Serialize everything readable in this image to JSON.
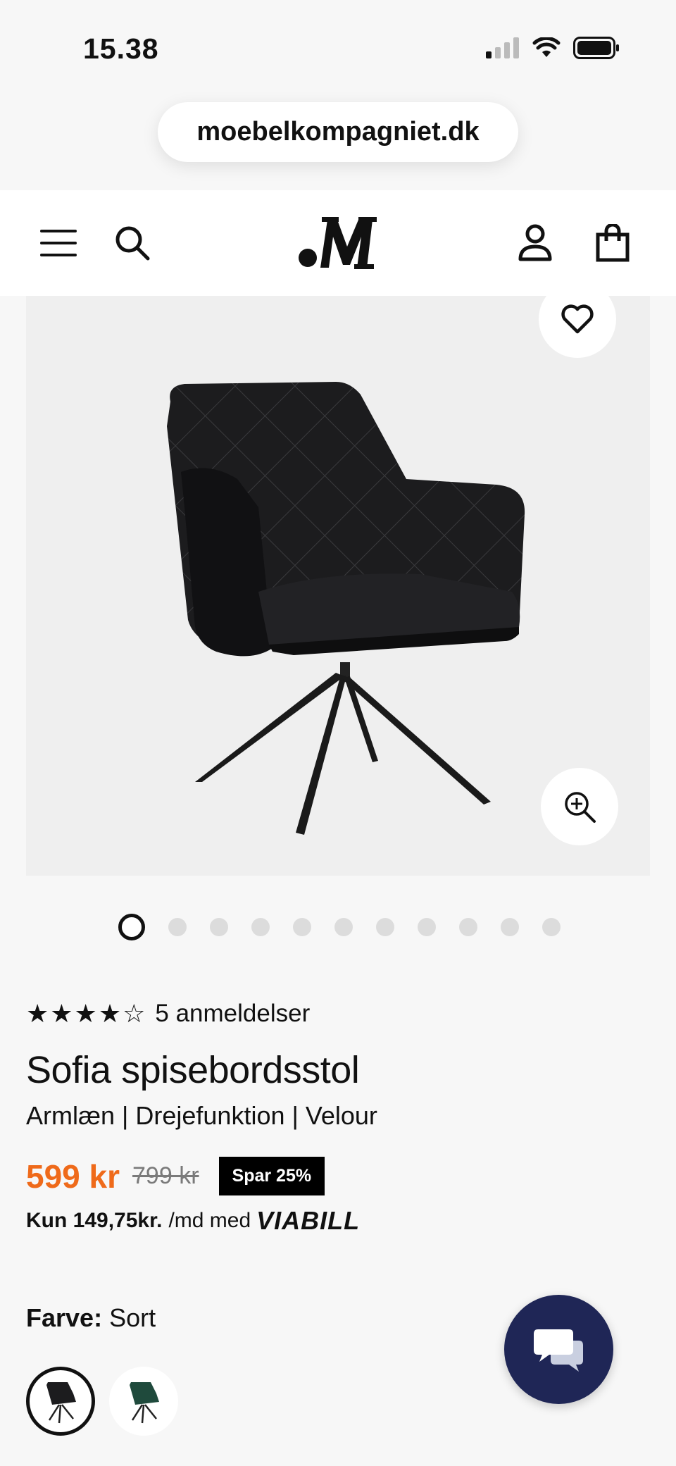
{
  "status_bar": {
    "time": "15.38"
  },
  "browser": {
    "url": "moebelkompagniet.dk"
  },
  "header": {
    "menu_icon": "hamburger-icon",
    "search_icon": "search-icon",
    "logo_text": ".M",
    "account_icon": "user-icon",
    "cart_icon": "shopping-bag-icon"
  },
  "gallery": {
    "image_count": 11,
    "active_index": 0,
    "favorite_icon": "heart-icon",
    "zoom_icon": "zoom-in-icon"
  },
  "product": {
    "rating": 4.5,
    "stars": "★★★★☆",
    "reviews": "5 anmeldelser",
    "title": "Sofia spisebordsstol",
    "subtitle": "Armlæn | Drejefunktion | Velour",
    "price": "599 kr",
    "old_price": "799 kr",
    "save_badge": "Spar 25%",
    "installment_bold": "Kun 149,75kr.",
    "installment_text": "/md med",
    "installment_provider": "VIABILL",
    "color_label": "Farve:",
    "color_value": "Sort",
    "colors": [
      "Sort",
      "Grøn"
    ]
  },
  "chat": {
    "icon": "chat-bubbles-icon"
  },
  "colors": {
    "price": "#ef6a1a",
    "chat_bg": "#1f2656",
    "badge_bg": "#000000"
  }
}
